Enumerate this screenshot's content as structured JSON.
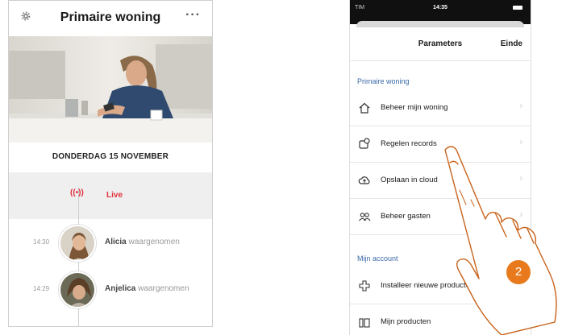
{
  "left_phone": {
    "title": "Primaire woning",
    "more_label": "···",
    "date_label": "DONDERDAG 15 NOVEMBER",
    "live_icon": "((•))",
    "live_label": "Live",
    "events": [
      {
        "time": "14:30",
        "name": "Alicia",
        "action": "waargenomen"
      },
      {
        "time": "14:29",
        "name": "Anjelica",
        "action": "waargenomen"
      }
    ],
    "icons": {
      "settings": "gear-icon",
      "more": "more-dots-icon",
      "live": "live-broadcast-icon"
    },
    "colors": {
      "live": "#e0303c"
    }
  },
  "right_phone": {
    "status_bar": {
      "carrier": "TIM",
      "time": "14:35"
    },
    "nav": {
      "title": "Parameters",
      "done_label": "Einde"
    },
    "sections": [
      {
        "title": "Primaire woning",
        "items": [
          {
            "label": "Beheer mijn woning",
            "icon": "home-icon"
          },
          {
            "label": "Regelen records",
            "icon": "record-settings-icon"
          },
          {
            "label": "Opslaan in cloud",
            "icon": "cloud-upload-icon"
          },
          {
            "label": "Beheer gasten",
            "icon": "guests-icon"
          }
        ]
      },
      {
        "title": "Mijn account",
        "items": [
          {
            "label": "Installeer nieuwe producten",
            "icon": "add-product-icon"
          },
          {
            "label": "Mijn producten",
            "icon": "products-icon"
          }
        ]
      }
    ],
    "chevron": "›",
    "colors": {
      "section_title": "#3b6aa8"
    }
  },
  "overlay": {
    "step_number": "2",
    "colors": {
      "accent": "#e87a1d"
    }
  }
}
